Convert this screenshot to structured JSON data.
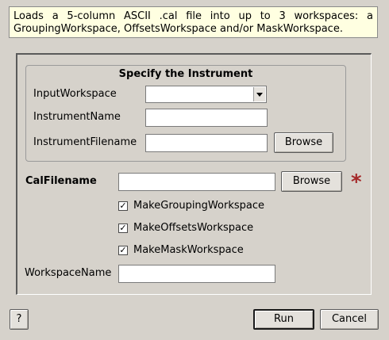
{
  "description": "Loads a 5-column ASCII .cal file into up to 3 workspaces: a GroupingWorkspace, OffsetsWorkspace and/or MaskWorkspace.",
  "instrument_group": {
    "title": "Specify the Instrument",
    "input_workspace_label": "InputWorkspace",
    "input_workspace_value": "",
    "instrument_name_label": "InstrumentName",
    "instrument_name_value": "",
    "instrument_filename_label": "InstrumentFilename",
    "instrument_filename_value": "",
    "browse_label": "Browse"
  },
  "cal_filename": {
    "label": "CalFilename",
    "value": "",
    "browse_label": "Browse",
    "required_marker": "*",
    "required_color": "#a52a2a"
  },
  "options": [
    {
      "label": "MakeGroupingWorkspace",
      "checked": true
    },
    {
      "label": "MakeOffsetsWorkspace",
      "checked": true
    },
    {
      "label": "MakeMaskWorkspace",
      "checked": true
    }
  ],
  "workspace_name": {
    "label": "WorkspaceName",
    "value": ""
  },
  "footer": {
    "help_label": "?",
    "run_label": "Run",
    "cancel_label": "Cancel"
  }
}
